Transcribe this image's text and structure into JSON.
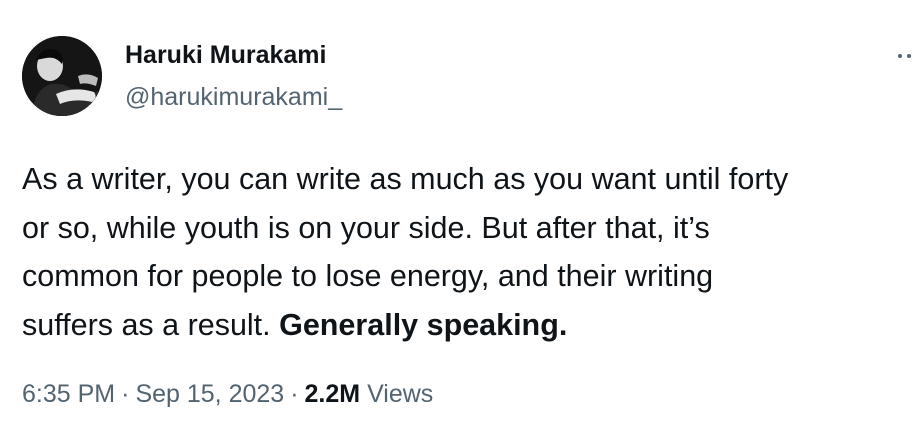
{
  "author": {
    "name": "Haruki Murakami",
    "handle": "@harukimurakami_",
    "avatar_icon": "profile-photo"
  },
  "more_icon": "more-options-icon",
  "tweet": {
    "lines": [
      "As a writer, you can write as much as you want until forty",
      "or so, while youth is on your side. But after that, it’s",
      "common for people to lose energy, and their writing"
    ],
    "last_line_plain": "suffers as a result. ",
    "last_line_bold": "Generally speaking."
  },
  "meta": {
    "time": "6:35 PM",
    "separator": "·",
    "date": "Sep 15, 2023",
    "views_count": "2.2M",
    "views_label": "Views"
  },
  "colors": {
    "text": "#0f1419",
    "secondary": "#536471",
    "background": "#ffffff"
  }
}
